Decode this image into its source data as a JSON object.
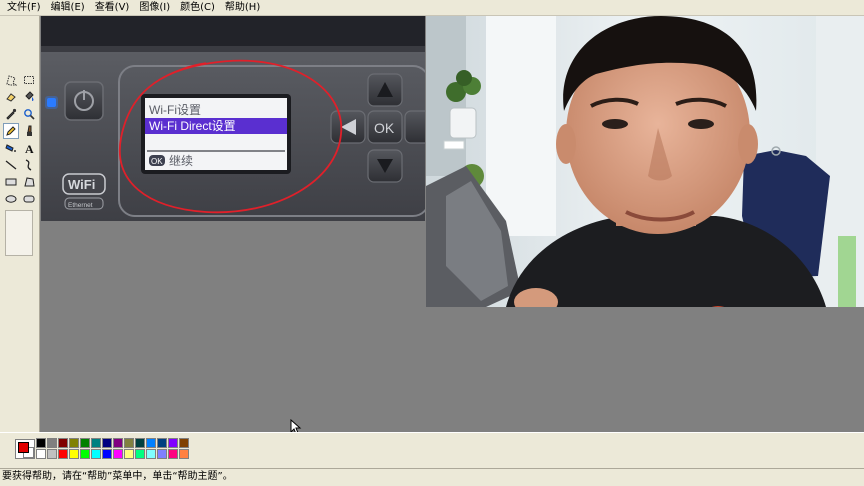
{
  "menu": [
    {
      "label": "文件(F)"
    },
    {
      "label": "编辑(E)"
    },
    {
      "label": "查看(V)"
    },
    {
      "label": "图像(I)"
    },
    {
      "label": "颜色(C)"
    },
    {
      "label": "帮助(H)"
    }
  ],
  "tools": [
    {
      "name": "free-form-select-icon"
    },
    {
      "name": "rect-select-icon"
    },
    {
      "name": "eraser-icon"
    },
    {
      "name": "fill-icon"
    },
    {
      "name": "color-picker-icon"
    },
    {
      "name": "magnifier-icon"
    },
    {
      "name": "pencil-icon",
      "active": true
    },
    {
      "name": "brush-icon"
    },
    {
      "name": "airbrush-icon"
    },
    {
      "name": "text-icon",
      "glyph": "A"
    },
    {
      "name": "line-icon"
    },
    {
      "name": "curve-icon"
    },
    {
      "name": "rectangle-icon"
    },
    {
      "name": "polygon-icon"
    },
    {
      "name": "ellipse-icon"
    },
    {
      "name": "rounded-rectangle-icon"
    }
  ],
  "printer_panel": {
    "lcd_line1": "Wi-Fi设置",
    "lcd_line2": "Wi-Fi Direct设置",
    "ok_badge": "OK",
    "lcd_line3": "继续",
    "ok_button": "OK",
    "wifi_logo": "WiFi",
    "ethernet_label": "Ethernet"
  },
  "palette": {
    "foreground": "#e00000",
    "background": "#ffffff",
    "colors": [
      "#000000",
      "#808080",
      "#800000",
      "#808000",
      "#008000",
      "#008080",
      "#000080",
      "#800080",
      "#808040",
      "#004040",
      "#0080ff",
      "#004080",
      "#8000ff",
      "#804000",
      "#ffffff",
      "#c0c0c0",
      "#ff0000",
      "#ffff00",
      "#00ff00",
      "#00ffff",
      "#0000ff",
      "#ff00ff",
      "#ffff80",
      "#00ff80",
      "#80ffff",
      "#8080ff",
      "#ff0080",
      "#ff8040"
    ]
  },
  "status": {
    "text": "要获得帮助，请在“帮助”菜单中，单击“帮助主题”。"
  },
  "colors": {
    "window_face": "#ece9d8",
    "canvas_background": "#808080",
    "lcd_highlight": "#5a2fd0",
    "annotation_red": "#e0202a"
  }
}
